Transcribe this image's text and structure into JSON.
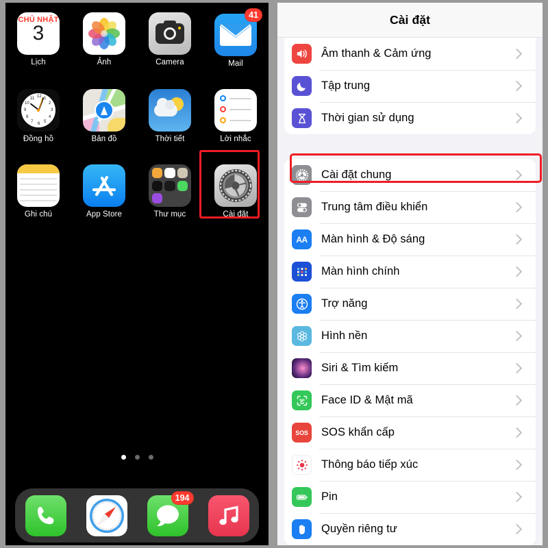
{
  "left_panel": {
    "name": "iphone-home-screen",
    "home_rows": [
      [
        {
          "app": "calendar",
          "label": "Lịch",
          "icon": "calendar-icon",
          "day_of_week": "CHỦ NHẬT",
          "day_number": "3",
          "badge": null
        },
        {
          "app": "photos",
          "label": "Ảnh",
          "icon": "photos-icon",
          "badge": null
        },
        {
          "app": "camera",
          "label": "Camera",
          "icon": "camera-icon",
          "badge": null
        },
        {
          "app": "mail",
          "label": "Mail",
          "icon": "mail-icon",
          "badge": "41"
        }
      ],
      [
        {
          "app": "clock",
          "label": "Đồng hồ",
          "icon": "clock-icon",
          "badge": null
        },
        {
          "app": "maps",
          "label": "Bản đồ",
          "icon": "maps-icon",
          "badge": null
        },
        {
          "app": "weather",
          "label": "Thời tiết",
          "icon": "weather-icon",
          "badge": null
        },
        {
          "app": "reminders",
          "label": "Lời nhắc",
          "icon": "reminders-icon",
          "badge": null
        }
      ],
      [
        {
          "app": "notes",
          "label": "Ghi chú",
          "icon": "notes-icon",
          "badge": null
        },
        {
          "app": "appstore",
          "label": "App Store",
          "icon": "app-store-icon",
          "badge": null
        },
        {
          "app": "folder",
          "label": "Thư mục",
          "icon": "folder-icon",
          "badge": null
        },
        {
          "app": "settings",
          "label": "Cài đặt",
          "icon": "settings-gear-icon",
          "badge": null,
          "highlighted": true
        }
      ]
    ],
    "page_dots": {
      "count": 3,
      "active_index": 0
    },
    "dock": [
      {
        "app": "phone",
        "icon": "phone-icon",
        "badge": null
      },
      {
        "app": "safari",
        "icon": "safari-compass-icon",
        "badge": null
      },
      {
        "app": "messages",
        "icon": "messages-bubble-icon",
        "badge": "194"
      },
      {
        "app": "music",
        "icon": "music-note-icon",
        "badge": null
      }
    ]
  },
  "right_panel": {
    "name": "ios-settings-app",
    "navbar": {
      "title": "Cài đặt"
    },
    "groups": [
      {
        "id": "group-sound",
        "rows": [
          {
            "label": "Âm thanh & Cảm ứng",
            "icon": "speaker-icon",
            "icon_class": "sp-speaker",
            "glyph": "🔊"
          },
          {
            "label": "Tập trung",
            "icon": "moon-icon",
            "icon_class": "sp-focus",
            "glyph": "🌙"
          },
          {
            "label": "Thời gian sử dụng",
            "icon": "hourglass-icon",
            "icon_class": "sp-screentime",
            "glyph": "⌛"
          }
        ]
      },
      {
        "id": "group-general",
        "highlight_row_index": 0,
        "rows": [
          {
            "label": "Cài đặt chung",
            "icon": "gear-icon",
            "icon_class": "sp-general",
            "glyph": "⚙"
          },
          {
            "label": "Trung tâm điều khiển",
            "icon": "control-center-icon",
            "icon_class": "sp-control",
            "glyph": "◎"
          },
          {
            "label": "Màn hình & Độ sáng",
            "icon": "display-brightness-icon",
            "icon_class": "sp-display",
            "glyph": "AA"
          },
          {
            "label": "Màn hình chính",
            "icon": "home-screen-icon",
            "icon_class": "sp-home",
            "glyph": "▦"
          },
          {
            "label": "Trợ năng",
            "icon": "accessibility-icon",
            "icon_class": "sp-access",
            "glyph": "◍"
          },
          {
            "label": "Hình nền",
            "icon": "wallpaper-icon",
            "icon_class": "sp-wall",
            "glyph": "❀"
          },
          {
            "label": "Siri & Tìm kiếm",
            "icon": "siri-icon",
            "icon_class": "sp-siri",
            "glyph": ""
          },
          {
            "label": "Face ID & Mật mã",
            "icon": "face-id-icon",
            "icon_class": "sp-faceid",
            "glyph": "☺"
          },
          {
            "label": "SOS khẩn cấp",
            "icon": "sos-icon",
            "icon_class": "sp-sos",
            "glyph": "SOS"
          },
          {
            "label": "Thông báo tiếp xúc",
            "icon": "exposure-notification-icon",
            "icon_class": "sp-expo",
            "glyph": "●"
          },
          {
            "label": "Pin",
            "icon": "battery-icon",
            "icon_class": "sp-battery",
            "glyph": "▭"
          },
          {
            "label": "Quyền riêng tư",
            "icon": "privacy-hand-icon",
            "icon_class": "sp-privacy",
            "glyph": "✋"
          }
        ]
      }
    ]
  },
  "annotations": {
    "highlight_color": "#ef1c23",
    "settings_app_box": "red-rectangle-around-settings-app",
    "general_row_box": "red-rectangle-around-cai-dat-chung-row"
  }
}
